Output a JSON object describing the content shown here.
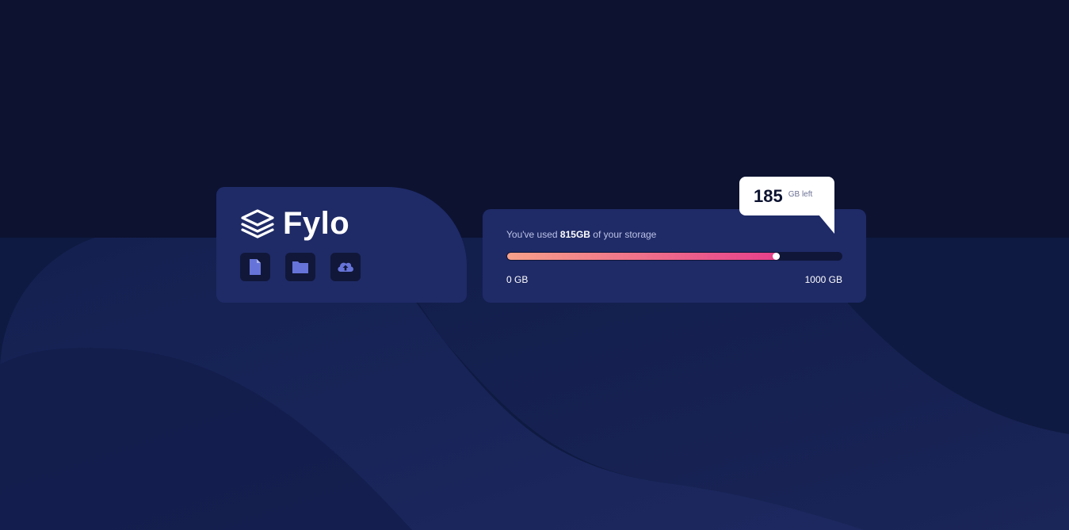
{
  "brand": {
    "name": "Fylo",
    "icons": [
      "document-icon",
      "folder-icon",
      "upload-icon"
    ]
  },
  "storage": {
    "used_prefix": "You've used",
    "used_amount": "815GB",
    "used_suffix": "of your storage",
    "used_value": 815,
    "total_value": 1000,
    "min_label": "0 GB",
    "max_label": "1000 GB",
    "remaining": "185",
    "remaining_unit": "GB left"
  },
  "colors": {
    "page_bg": "#0c1230",
    "card_bg": "#1f2b67",
    "icon_bg": "#111739",
    "icon_fg": "#6674d9",
    "gradient_start": "#f7a18a",
    "gradient_end": "#e63f8b"
  }
}
